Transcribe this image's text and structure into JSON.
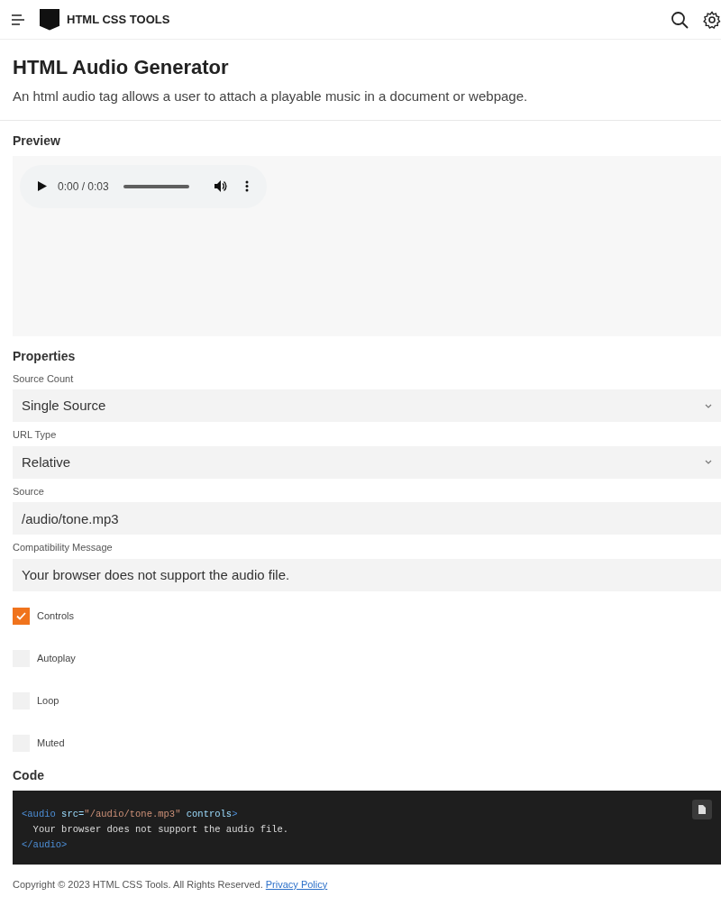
{
  "navbar": {
    "brand": "HTML CSS TOOLS"
  },
  "header": {
    "title": "HTML Audio Generator",
    "description": "An html audio tag allows a user to attach a playable music in a document or webpage."
  },
  "preview": {
    "heading": "Preview",
    "player": {
      "time": "0:00 / 0:03"
    }
  },
  "properties": {
    "heading": "Properties",
    "fields": [
      {
        "kind": "select",
        "label": "Source Count",
        "value": "Single Source"
      },
      {
        "kind": "select",
        "label": "URL Type",
        "value": "Relative"
      },
      {
        "kind": "input",
        "label": "Source",
        "value": "/audio/tone.mp3"
      },
      {
        "kind": "input",
        "label": "Compatibility Message",
        "value": "Your browser does not support the audio file."
      }
    ],
    "options": [
      {
        "label": "Controls",
        "checked": true
      },
      {
        "label": "Autoplay",
        "checked": false
      },
      {
        "label": "Loop",
        "checked": false
      },
      {
        "label": "Muted",
        "checked": false
      }
    ]
  },
  "code": {
    "heading": "Code",
    "lines": [
      [
        {
          "kind": "tag",
          "text": "<audio"
        },
        {
          "kind": "attr",
          "text": " src="
        },
        {
          "kind": "string",
          "text": "\"/audio/tone.mp3\""
        },
        {
          "kind": "attr",
          "text": " controls"
        },
        {
          "kind": "tag",
          "text": ">"
        }
      ],
      [
        {
          "kind": "text",
          "text": "  Your browser does not support the audio file."
        }
      ],
      [
        {
          "kind": "tag",
          "text": "</audio>"
        }
      ]
    ]
  },
  "footer": {
    "text": "Copyright © 2023 HTML CSS Tools. All Rights Reserved.",
    "link": "Privacy Policy"
  }
}
